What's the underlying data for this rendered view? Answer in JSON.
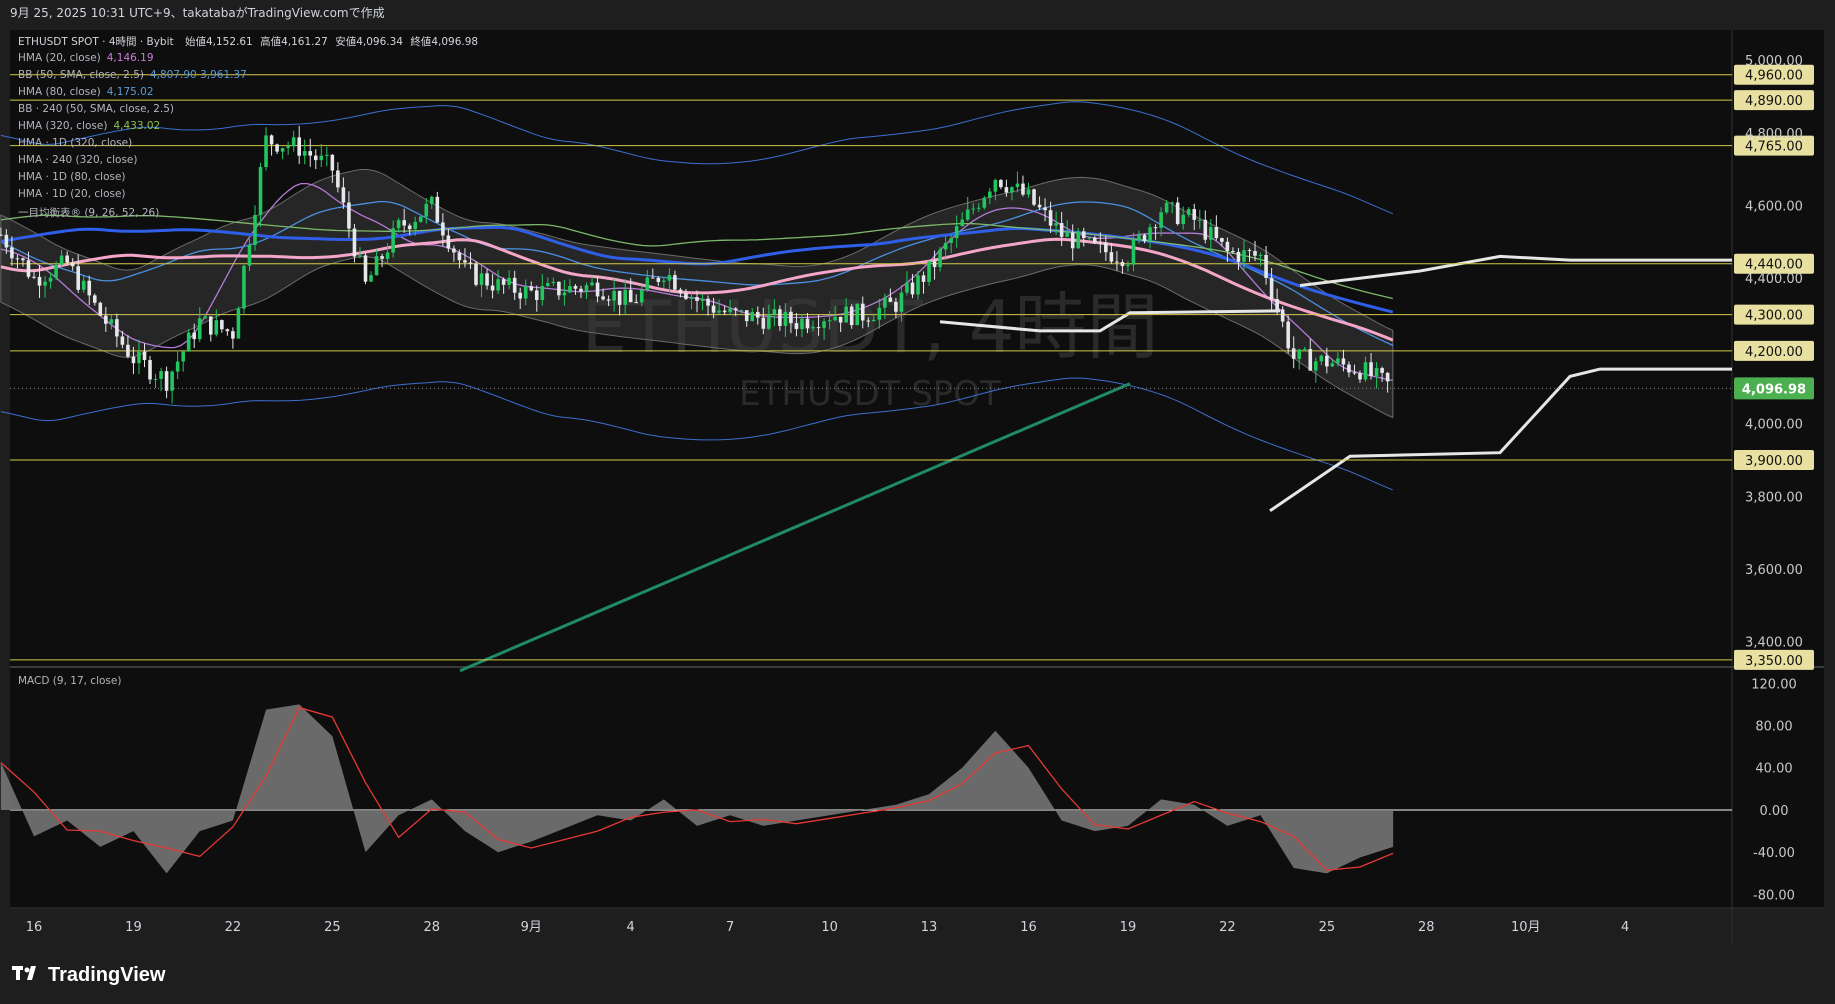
{
  "header": {
    "text": "9月 25, 2025 10:31 UTC+9、takatabaがTradingView.comで作成"
  },
  "footer": {
    "brand": "TradingView"
  },
  "legend": {
    "title": "ETHUSDT SPOT · 4時間 · Bybit",
    "o_label": "始値",
    "o": "4,152.61",
    "h_label": "高値",
    "h": "4,161.27",
    "l_label": "安値",
    "l": "4,096.34",
    "c_label": "終値",
    "c": "4,096.98",
    "rows": [
      {
        "label": "HMA (20, close)",
        "value": "4,146.19",
        "color": "#c77dd8"
      },
      {
        "label": "BB (50, SMA, close, 2.5)",
        "value": "4,807.90  3,961.37",
        "color": "#5b9bd5"
      },
      {
        "label": "HMA (80, close)",
        "value": "4,175.02",
        "color": "#5b9bd5"
      },
      {
        "label": "BB · 240 (50, SMA, close, 2.5)",
        "value": "",
        "color": "#b2b5be"
      },
      {
        "label": "HMA (320, close)",
        "value": "4,433.02",
        "color": "#8bc34a"
      },
      {
        "label": "HMA · 1D (320, close)",
        "value": "",
        "color": "#b2b5be"
      },
      {
        "label": "HMA · 240 (320, close)",
        "value": "",
        "color": "#b2b5be"
      },
      {
        "label": "HMA · 1D (80, close)",
        "value": "",
        "color": "#b2b5be"
      },
      {
        "label": "HMA · 1D (20, close)",
        "value": "",
        "color": "#b2b5be"
      },
      {
        "label": "一目均衡表® (9, 26, 52, 26)",
        "value": "",
        "color": "#b2b5be"
      }
    ]
  },
  "watermark": {
    "main": "ETHUSDT, 4時間",
    "sub": "ETHUSDT SPOT"
  },
  "macd_label": "MACD (9, 17, close)",
  "colors": {
    "up": "#22c55e",
    "down": "#e5e7eb",
    "hline": "#d4c84a",
    "price_badge": "#4caf50",
    "bg": "#0e0e0e"
  },
  "chart_data": {
    "type": "candlestick",
    "x_ticks": [
      "16",
      "19",
      "22",
      "25",
      "28",
      "9月",
      "4",
      "7",
      "10",
      "13",
      "16",
      "19",
      "22",
      "25",
      "28",
      "10月",
      "4"
    ],
    "price_ticks": [
      "5,000.00",
      "4,800.00",
      "4,600.00",
      "4,400.00",
      "4,000.00",
      "3,800.00",
      "3,600.00",
      "3,400.00"
    ],
    "ylim": [
      3300,
      5050
    ],
    "horizontal_levels": [
      "4,960.00",
      "4,890.00",
      "4,765.00",
      "4,440.00",
      "4,300.00",
      "4,200.00",
      "3,900.00",
      "3,350.00"
    ],
    "last_price": "4,096.98",
    "close_path": [
      [
        "Aug 15",
        4520
      ],
      [
        "Aug 16",
        4400
      ],
      [
        "Aug 17",
        4440
      ],
      [
        "Aug 18",
        4300
      ],
      [
        "Aug 19",
        4180
      ],
      [
        "Aug 20",
        4120
      ],
      [
        "Aug 21",
        4280
      ],
      [
        "Aug 22",
        4250
      ],
      [
        "Aug 23",
        4780
      ],
      [
        "Aug 24",
        4760
      ],
      [
        "Aug 25",
        4700
      ],
      [
        "Aug 26",
        4380
      ],
      [
        "Aug 27",
        4540
      ],
      [
        "Aug 28",
        4600
      ],
      [
        "Aug 29",
        4420
      ],
      [
        "Aug 30",
        4380
      ],
      [
        "Aug 31",
        4360
      ],
      [
        "Sep 1",
        4380
      ],
      [
        "Sep 2",
        4330
      ],
      [
        "Sep 3",
        4420
      ],
      [
        "Sep 4",
        4340
      ],
      [
        "Sep 5",
        4300
      ],
      [
        "Sep 6",
        4290
      ],
      [
        "Sep 7",
        4280
      ],
      [
        "Sep 8",
        4300
      ],
      [
        "Sep 9",
        4300
      ],
      [
        "Sep 10",
        4330
      ],
      [
        "Sep 11",
        4420
      ],
      [
        "Sep 12",
        4550
      ],
      [
        "Sep 13",
        4680
      ],
      [
        "Sep 14",
        4620
      ],
      [
        "Sep 15",
        4520
      ],
      [
        "Sep 16",
        4480
      ],
      [
        "Sep 17",
        4460
      ],
      [
        "Sep 18",
        4590
      ],
      [
        "Sep 19",
        4560
      ],
      [
        "Sep 20",
        4470
      ],
      [
        "Sep 21",
        4460
      ],
      [
        "Sep 22",
        4180
      ],
      [
        "Sep 23",
        4170
      ],
      [
        "Sep 24",
        4150
      ],
      [
        "Sep 25",
        4097
      ]
    ],
    "macd": {
      "yticks": [
        "120.00",
        "80.00",
        "40.00",
        "0.00",
        "-40.00",
        "-80.00"
      ],
      "ylim": [
        -90,
        125
      ],
      "histogram": [
        [
          "Aug 15",
          45
        ],
        [
          "Aug 16",
          -25
        ],
        [
          "Aug 17",
          -10
        ],
        [
          "Aug 18",
          -35
        ],
        [
          "Aug 19",
          -20
        ],
        [
          "Aug 20",
          -60
        ],
        [
          "Aug 21",
          -20
        ],
        [
          "Aug 22",
          -10
        ],
        [
          "Aug 23",
          95
        ],
        [
          "Aug 24",
          100
        ],
        [
          "Aug 25",
          70
        ],
        [
          "Aug 26",
          -40
        ],
        [
          "Aug 27",
          -5
        ],
        [
          "Aug 28",
          10
        ],
        [
          "Aug 29",
          -20
        ],
        [
          "Aug 30",
          -40
        ],
        [
          "Aug 31",
          -30
        ],
        [
          "Sep 1",
          -5
        ],
        [
          "Sep 2",
          -10
        ],
        [
          "Sep 3",
          10
        ],
        [
          "Sep 4",
          -15
        ],
        [
          "Sep 5",
          -5
        ],
        [
          "Sep 6",
          -15
        ],
        [
          "Sep 7",
          -10
        ],
        [
          "Sep 8",
          -5
        ],
        [
          "Sep 9",
          0
        ],
        [
          "Sep 10",
          5
        ],
        [
          "Sep 11",
          15
        ],
        [
          "Sep 12",
          40
        ],
        [
          "Sep 13",
          75
        ],
        [
          "Sep 14",
          40
        ],
        [
          "Sep 15",
          -10
        ],
        [
          "Sep 16",
          -20
        ],
        [
          "Sep 17",
          -15
        ],
        [
          "Sep 18",
          10
        ],
        [
          "Sep 19",
          5
        ],
        [
          "Sep 20",
          -15
        ],
        [
          "Sep 21",
          -5
        ],
        [
          "Sep 22",
          -55
        ],
        [
          "Sep 23",
          -60
        ],
        [
          "Sep 24",
          -45
        ],
        [
          "Sep 25",
          -35
        ]
      ]
    }
  }
}
